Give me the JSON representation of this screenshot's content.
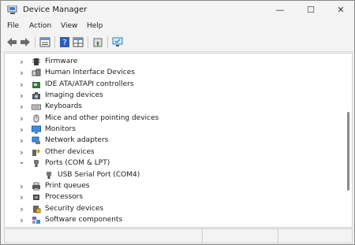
{
  "window": {
    "title": "Device Manager",
    "controls": {
      "minimize": "—",
      "maximize": "☐",
      "close": "✕"
    }
  },
  "menu": [
    {
      "label": "File",
      "name": "menu-file"
    },
    {
      "label": "Action",
      "name": "menu-action"
    },
    {
      "label": "View",
      "name": "menu-view"
    },
    {
      "label": "Help",
      "name": "menu-help"
    }
  ],
  "toolbar": [
    {
      "icon": "back-arrow-icon",
      "color": "#6b6b6b"
    },
    {
      "icon": "forward-arrow-icon",
      "color": "#6b6b6b"
    },
    {
      "icon": "properties-sheet-icon",
      "color": "#4a4a4a"
    },
    {
      "icon": "help-icon",
      "color": "#2d5fb8"
    },
    {
      "icon": "grid-view-icon",
      "color": "#4a4a4a"
    },
    {
      "icon": "update-driver-icon",
      "color": "#3b8a3b"
    },
    {
      "icon": "scan-hardware-icon",
      "color": "#1f7fc9"
    }
  ],
  "tree": [
    {
      "label": "Firmware",
      "icon": "firmware-chip-icon",
      "expanded": false,
      "level": 0
    },
    {
      "label": "Human Interface Devices",
      "icon": "hid-icon",
      "expanded": false,
      "level": 0
    },
    {
      "label": "IDE ATA/ATAPI controllers",
      "icon": "ide-controller-icon",
      "expanded": false,
      "level": 0
    },
    {
      "label": "Imaging devices",
      "icon": "camera-icon",
      "expanded": false,
      "level": 0
    },
    {
      "label": "Keyboards",
      "icon": "keyboard-icon",
      "expanded": false,
      "level": 0
    },
    {
      "label": "Mice and other pointing devices",
      "icon": "mouse-icon",
      "expanded": false,
      "level": 0
    },
    {
      "label": "Monitors",
      "icon": "monitor-icon",
      "expanded": false,
      "level": 0
    },
    {
      "label": "Network adapters",
      "icon": "network-adapter-icon",
      "expanded": false,
      "level": 0
    },
    {
      "label": "Other devices",
      "icon": "other-devices-icon",
      "expanded": false,
      "level": 0
    },
    {
      "label": "Ports (COM & LPT)",
      "icon": "port-icon",
      "expanded": true,
      "level": 0
    },
    {
      "label": "USB Serial Port (COM4)",
      "icon": "port-icon",
      "expanded": null,
      "level": 1
    },
    {
      "label": "Print queues",
      "icon": "printer-icon",
      "expanded": false,
      "level": 0
    },
    {
      "label": "Processors",
      "icon": "processor-icon",
      "expanded": false,
      "level": 0
    },
    {
      "label": "Security devices",
      "icon": "security-icon",
      "expanded": false,
      "level": 0
    },
    {
      "label": "Software components",
      "icon": "software-component-icon",
      "expanded": false,
      "level": 0
    }
  ]
}
